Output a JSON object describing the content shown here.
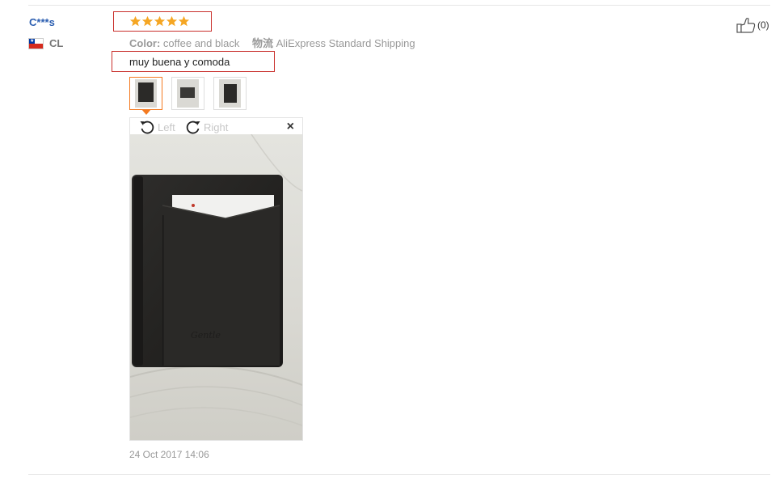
{
  "review": {
    "user_name": "C***s",
    "country_code": "CL",
    "rating": 5,
    "max_rating": 5,
    "color_label": "Color:",
    "color_value": "coffee and black",
    "shipping_label": "物流",
    "shipping_value": "AliExpress Standard Shipping",
    "text": "muy buena y comoda",
    "date": "24 Oct 2017 14:06",
    "helpful_count": "(0)"
  },
  "viewer": {
    "rotate_left_label": "Left",
    "rotate_right_label": "Right",
    "close_symbol": "×"
  },
  "thumbnails": [
    {
      "name": "photo-1",
      "active": true
    },
    {
      "name": "photo-2",
      "active": false
    },
    {
      "name": "photo-3",
      "active": false
    }
  ],
  "colors": {
    "username": "#2a5db0",
    "star": "#f5a623",
    "highlight_border": "#c9302c",
    "active_thumb": "#f47a20"
  },
  "icons": {
    "flag": "chile-flag-icon",
    "star": "star-icon",
    "rotate_left": "rotate-left-icon",
    "rotate_right": "rotate-right-icon",
    "close": "close-icon",
    "helpful": "thumbs-up-icon"
  }
}
